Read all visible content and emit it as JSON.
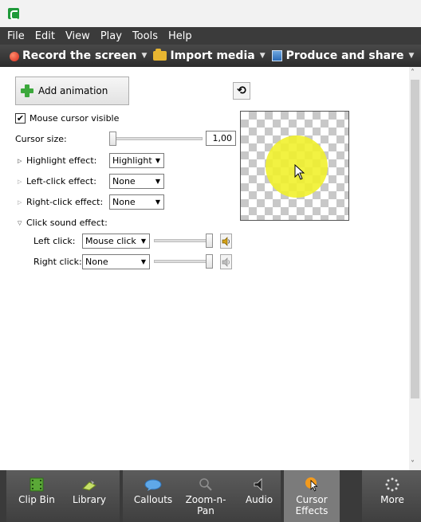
{
  "menu": [
    "File",
    "Edit",
    "View",
    "Play",
    "Tools",
    "Help"
  ],
  "tasks": {
    "record": "Record the screen",
    "import": "Import media",
    "produce": "Produce and share"
  },
  "panel": {
    "add_animation": "Add animation",
    "mouse_cursor_visible": "Mouse cursor visible",
    "cursor_size_label": "Cursor size:",
    "cursor_size_value": "1,00",
    "highlight_label": "Highlight effect:",
    "highlight_value": "Highlight",
    "left_click_label": "Left-click effect:",
    "left_click_value": "None",
    "right_click_label": "Right-click effect:",
    "right_click_value": "None",
    "click_sound_label": "Click sound effect:",
    "left_click_sound_label": "Left click:",
    "left_click_sound_value": "Mouse click",
    "right_click_sound_label": "Right click:",
    "right_click_sound_value": "None"
  },
  "tabs": {
    "clip_bin": "Clip Bin",
    "library": "Library",
    "callouts": "Callouts",
    "zoom_pan": "Zoom-n-\nPan",
    "audio": "Audio",
    "cursor_effects": "Cursor\nEffects",
    "more": "More"
  },
  "colors": {
    "highlight": "#f0f028",
    "accent_green": "#1f9a3a"
  }
}
